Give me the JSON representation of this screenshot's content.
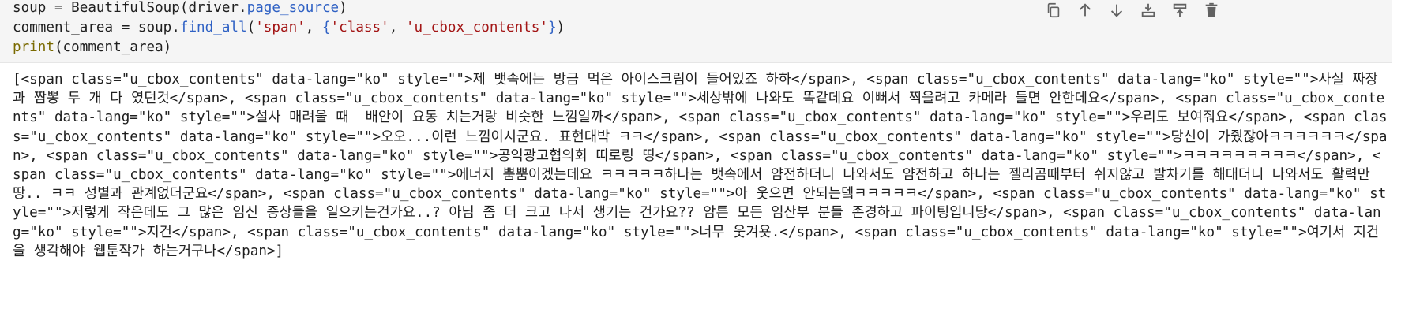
{
  "code": {
    "line1": {
      "var": "soup",
      "eq": " = ",
      "call": "BeautifulSoup(driver.",
      "attr": "page_source",
      "close": ")"
    },
    "line2": {
      "var": "comment_area",
      "eq": " = ",
      "obj": "soup.",
      "method": "find_all",
      "open": "(",
      "s1": "'span'",
      "comma": ", ",
      "brace_open": "{",
      "s2": "'class'",
      "colon": ", ",
      "s3": "'u_cbox_contents'",
      "brace_close": "}",
      "close": ")"
    },
    "line3": {
      "fn": "print",
      "args": "(comment_area)"
    }
  },
  "toolbar": {
    "icons": [
      "copy-icon",
      "arrow-up-icon",
      "arrow-down-icon",
      "insert-below-icon",
      "insert-above-icon",
      "trash-icon"
    ],
    "icon_color": "#616161"
  },
  "output": {
    "text": "[<span class=\"u_cbox_contents\" data-lang=\"ko\" style=\"\">제 뱃속에는 방금 먹은 아이스크림이 들어있죠 하하</span>, <span class=\"u_cbox_contents\" data-lang=\"ko\" style=\"\">사실 짜장과 짬뽕 두 개 다 였던것</span>, <span class=\"u_cbox_contents\" data-lang=\"ko\" style=\"\">세상밖에 나와도 똑같데요 이뻐서 찍을려고 카메라 들면 안한데요</span>, <span class=\"u_cbox_contents\" data-lang=\"ko\" style=\"\">설사 매려울 때  배안이 요동 치는거랑 비슷한 느낌일까</span>, <span class=\"u_cbox_contents\" data-lang=\"ko\" style=\"\">우리도 보여줘요</span>, <span class=\"u_cbox_contents\" data-lang=\"ko\" style=\"\">오오...이런 느낌이시군요. 표현대박 ㅋㅋ</span>, <span class=\"u_cbox_contents\" data-lang=\"ko\" style=\"\">당신이 가줬잖아ㅋㅋㅋㅋㅋㅋ</span>, <span class=\"u_cbox_contents\" data-lang=\"ko\" style=\"\">공익광고협의회 띠로링 띵</span>, <span class=\"u_cbox_contents\" data-lang=\"ko\" style=\"\">ㅋㅋㅋㅋㅋㅋㅋㅋㅋ</span>, <span class=\"u_cbox_contents\" data-lang=\"ko\" style=\"\">에너지 뿜뿜이겠는데요 ㅋㅋㅋㅋㅋ하나는 뱃속에서 얌전하더니 나와서도 얌전하고 하나는 젤리곰때부터 쉬지않고 발차기를 해대더니 나와서도 활력만땅.. ㅋㅋ 성별과 관계없더군요</span>, <span class=\"u_cbox_contents\" data-lang=\"ko\" style=\"\">아 웃으면 안되는뎈ㅋㅋㅋㅋㅋ</span>, <span class=\"u_cbox_contents\" data-lang=\"ko\" style=\"\">저렇게 작은데도 그 많은 임신 증상들을 일으키는건가요..? 아님 좀 더 크고 나서 생기는 건가요?? 암튼 모든 임산부 분들 존경하고 파이팅입니당</span>, <span class=\"u_cbox_contents\" data-lang=\"ko\" style=\"\">지건</span>, <span class=\"u_cbox_contents\" data-lang=\"ko\" style=\"\">너무 웃겨욧.</span>, <span class=\"u_cbox_contents\" data-lang=\"ko\" style=\"\">여기서 지건을 생각해야 웹툰작가 하는거구나</span>]"
  }
}
